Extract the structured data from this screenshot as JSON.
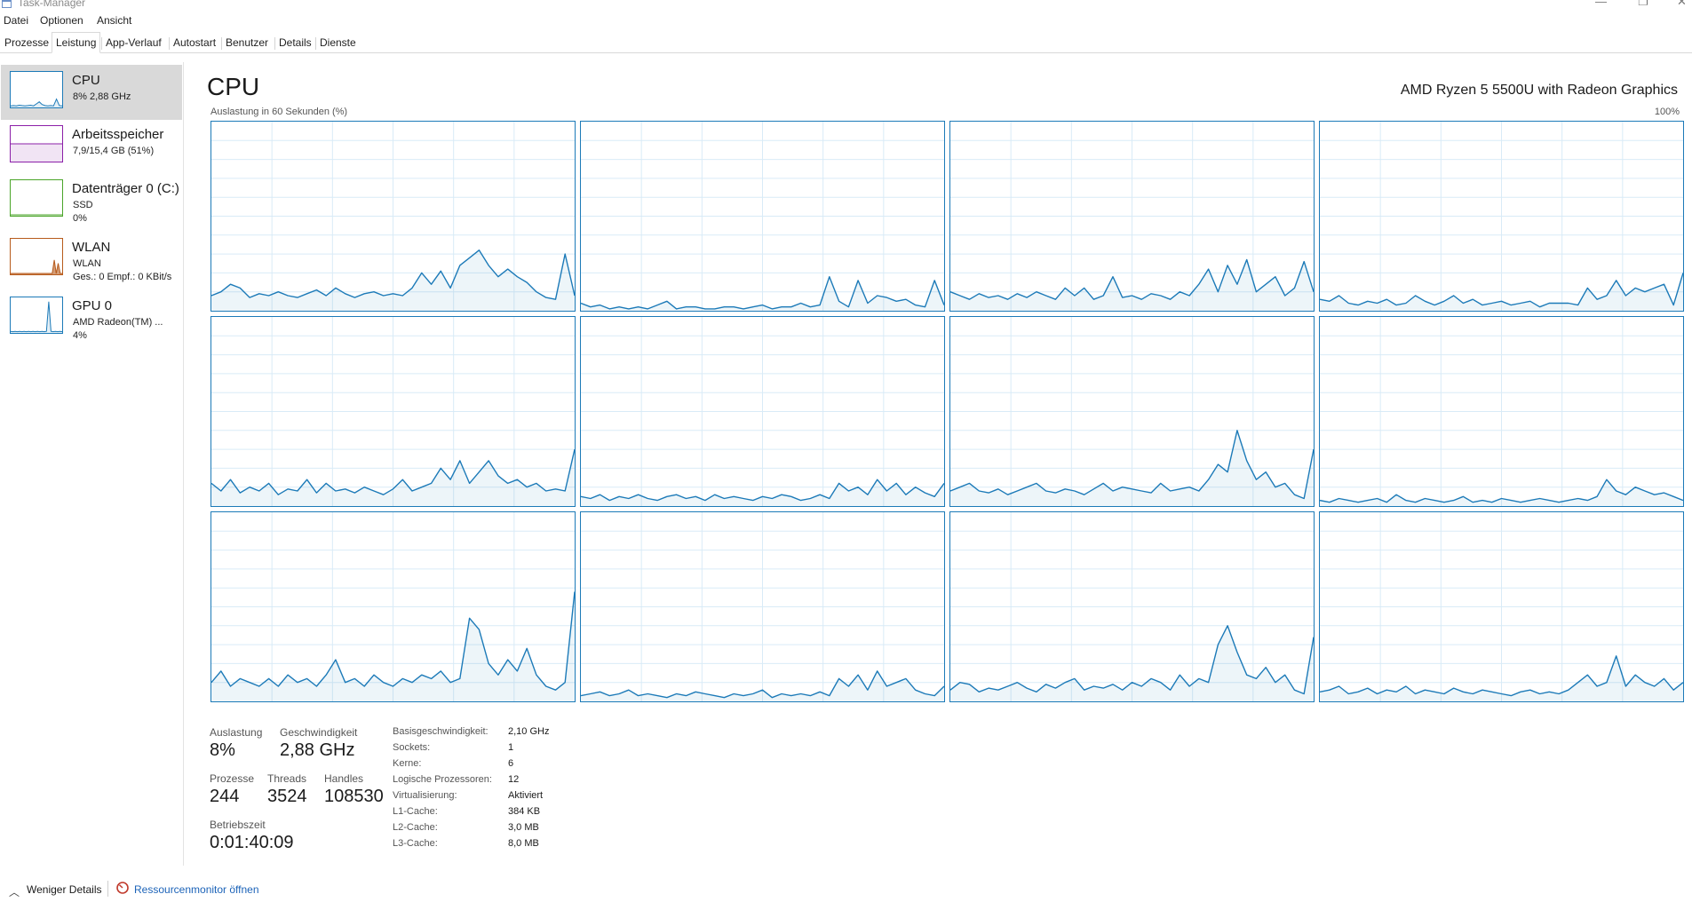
{
  "window": {
    "title": "Task-Manager"
  },
  "menu": [
    "Datei",
    "Optionen",
    "Ansicht"
  ],
  "tabs": [
    "Prozesse",
    "Leistung",
    "App-Verlauf",
    "Autostart",
    "Benutzer",
    "Details",
    "Dienste"
  ],
  "active_tab": "Leistung",
  "sidebar": {
    "items": [
      {
        "name": "CPU",
        "lines": [
          "8% 2,88 GHz"
        ],
        "color": "#1c7ab8"
      },
      {
        "name": "Arbeitsspeicher",
        "lines": [
          "7,9/15,4 GB (51%)"
        ],
        "color": "#8b1fa8"
      },
      {
        "name": "Datenträger 0 (C:)",
        "lines": [
          "SSD",
          "0%"
        ],
        "color": "#4aa529"
      },
      {
        "name": "WLAN",
        "lines": [
          "WLAN",
          "Ges.: 0 Empf.: 0 KBit/s"
        ],
        "color": "#b75b1c"
      },
      {
        "name": "GPU 0",
        "lines": [
          "AMD Radeon(TM) ...",
          "4%"
        ],
        "color": "#1c7ab8"
      }
    ]
  },
  "main": {
    "title": "CPU",
    "model": "AMD Ryzen 5 5500U with Radeon Graphics",
    "axis_label": "Auslastung in 60 Sekunden (%)",
    "axis_max": "100%"
  },
  "stats": {
    "auslastung_label": "Auslastung",
    "auslastung": "8%",
    "geschwindigkeit_label": "Geschwindigkeit",
    "geschwindigkeit": "2,88 GHz",
    "prozesse_label": "Prozesse",
    "prozesse": "244",
    "threads_label": "Threads",
    "threads": "3524",
    "handles_label": "Handles",
    "handles": "108530",
    "betriebszeit_label": "Betriebszeit",
    "betriebszeit": "0:01:40:09"
  },
  "details": [
    {
      "key": "Basisgeschwindigkeit:",
      "value": "2,10 GHz"
    },
    {
      "key": "Sockets:",
      "value": "1"
    },
    {
      "key": "Kerne:",
      "value": "6"
    },
    {
      "key": "Logische Prozessoren:",
      "value": "12"
    },
    {
      "key": "Virtualisierung:",
      "value": "Aktiviert"
    },
    {
      "key": "L1-Cache:",
      "value": "384 KB"
    },
    {
      "key": "L2-Cache:",
      "value": "3,0 MB"
    },
    {
      "key": "L3-Cache:",
      "value": "8,0 MB"
    }
  ],
  "footer": {
    "less_details": "Weniger Details",
    "resource_monitor": "Ressourcenmonitor öffnen"
  },
  "icons": {
    "collapse": "chevron-up-icon",
    "resmon": "resource-monitor-icon"
  },
  "chart_data": {
    "type": "area",
    "ylim": [
      0,
      100
    ],
    "grid": true,
    "series": [
      {
        "values": [
          8,
          10,
          14,
          12,
          7,
          9,
          8,
          10,
          8,
          7,
          9,
          11,
          8,
          12,
          9,
          7,
          9,
          10,
          8,
          9,
          8,
          12,
          20,
          14,
          21,
          12,
          24,
          28,
          32,
          24,
          18,
          22,
          18,
          15,
          10,
          7,
          6,
          30,
          8
        ]
      },
      {
        "values": [
          4,
          2,
          3,
          1,
          2,
          1,
          2,
          1,
          3,
          5,
          1,
          2,
          2,
          1,
          1,
          2,
          2,
          1,
          2,
          3,
          1,
          2,
          2,
          4,
          2,
          3,
          18,
          5,
          2,
          16,
          4,
          8,
          7,
          5,
          6,
          3,
          2,
          16,
          3
        ]
      },
      {
        "values": [
          10,
          8,
          6,
          9,
          7,
          8,
          6,
          9,
          7,
          10,
          8,
          6,
          12,
          8,
          12,
          6,
          8,
          18,
          7,
          8,
          6,
          9,
          8,
          6,
          10,
          8,
          14,
          22,
          10,
          24,
          14,
          27,
          10,
          14,
          18,
          8,
          12,
          26,
          10
        ]
      },
      {
        "values": [
          6,
          5,
          8,
          4,
          3,
          5,
          4,
          6,
          3,
          4,
          8,
          5,
          3,
          5,
          8,
          4,
          6,
          3,
          4,
          5,
          3,
          4,
          5,
          2,
          4,
          4,
          4,
          3,
          12,
          6,
          8,
          16,
          8,
          12,
          10,
          12,
          14,
          3,
          20
        ]
      },
      {
        "values": [
          12,
          8,
          14,
          7,
          10,
          8,
          12,
          6,
          9,
          8,
          14,
          7,
          12,
          8,
          9,
          7,
          10,
          8,
          6,
          9,
          14,
          8,
          10,
          12,
          20,
          14,
          24,
          12,
          18,
          24,
          16,
          12,
          14,
          10,
          12,
          8,
          9,
          8,
          30
        ]
      },
      {
        "values": [
          5,
          4,
          6,
          3,
          5,
          4,
          6,
          4,
          3,
          5,
          6,
          4,
          5,
          3,
          6,
          4,
          5,
          4,
          3,
          5,
          4,
          6,
          5,
          3,
          4,
          6,
          4,
          12,
          8,
          10,
          6,
          14,
          8,
          12,
          6,
          10,
          7,
          5,
          12
        ]
      },
      {
        "values": [
          8,
          10,
          12,
          8,
          7,
          9,
          6,
          8,
          10,
          12,
          8,
          7,
          9,
          8,
          6,
          9,
          12,
          8,
          10,
          9,
          8,
          7,
          12,
          8,
          9,
          10,
          8,
          14,
          22,
          18,
          40,
          24,
          14,
          18,
          10,
          12,
          6,
          4,
          30
        ]
      },
      {
        "values": [
          3,
          2,
          4,
          3,
          2,
          3,
          4,
          2,
          6,
          3,
          2,
          4,
          3,
          2,
          3,
          5,
          2,
          3,
          2,
          4,
          3,
          2,
          3,
          4,
          3,
          2,
          3,
          4,
          3,
          5,
          14,
          8,
          6,
          10,
          8,
          6,
          7,
          5,
          3
        ]
      },
      {
        "values": [
          10,
          16,
          8,
          12,
          10,
          8,
          12,
          8,
          14,
          10,
          12,
          8,
          14,
          22,
          10,
          12,
          8,
          14,
          10,
          8,
          12,
          10,
          14,
          12,
          16,
          10,
          12,
          44,
          38,
          20,
          14,
          22,
          16,
          28,
          14,
          8,
          6,
          10,
          58
        ]
      },
      {
        "values": [
          3,
          4,
          5,
          3,
          4,
          6,
          3,
          4,
          3,
          2,
          4,
          3,
          5,
          4,
          3,
          2,
          4,
          3,
          4,
          6,
          2,
          4,
          3,
          4,
          3,
          5,
          3,
          12,
          8,
          14,
          6,
          16,
          8,
          10,
          12,
          6,
          4,
          3,
          8
        ]
      },
      {
        "values": [
          6,
          10,
          9,
          5,
          7,
          6,
          8,
          10,
          7,
          5,
          9,
          7,
          10,
          12,
          6,
          8,
          7,
          9,
          6,
          10,
          8,
          12,
          10,
          6,
          14,
          8,
          12,
          10,
          30,
          40,
          26,
          14,
          12,
          18,
          10,
          14,
          6,
          4,
          34
        ]
      },
      {
        "values": [
          5,
          6,
          8,
          4,
          5,
          7,
          4,
          6,
          5,
          8,
          4,
          6,
          5,
          4,
          7,
          5,
          4,
          6,
          5,
          4,
          3,
          5,
          6,
          4,
          5,
          4,
          6,
          10,
          14,
          8,
          10,
          24,
          8,
          14,
          10,
          8,
          12,
          6,
          10
        ]
      }
    ]
  }
}
